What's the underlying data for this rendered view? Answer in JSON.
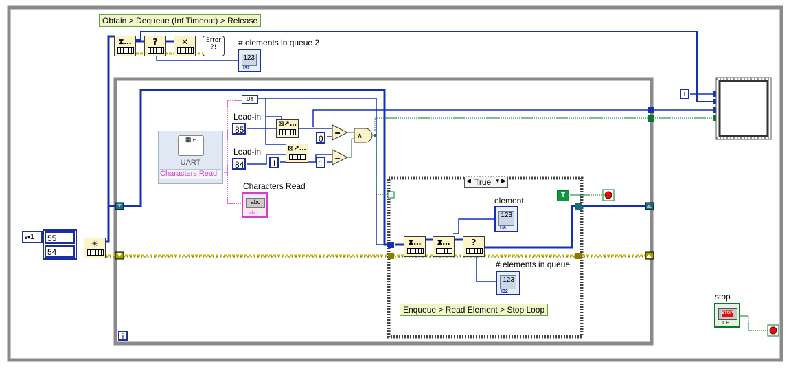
{
  "comments": {
    "top": "Obtain > Dequeue (Inf Timeout) > Release",
    "inner": "Enqueue > Read Element > Stop Loop"
  },
  "labels": {
    "elements_in_queue_2": "# elements in queue 2",
    "lead_in_1": "Lead-in",
    "lead_in_2": "Lead-in",
    "characters_read": "Characters Read",
    "element": "element",
    "elements_in_queue": "# elements in queue",
    "stop": "stop"
  },
  "constants": {
    "queue_size": "1",
    "array_v1": "55",
    "array_v2": "54",
    "lead_in_85": "85",
    "lead_in_84": "84",
    "zero": "0",
    "one_a": "1",
    "one_b": "1",
    "true_const": "T",
    "loop_iter": "i",
    "outer_iter": "i",
    "u8_tag": "U8"
  },
  "uart": {
    "title": "UART",
    "port": "Characters Read"
  },
  "case_selector": "True",
  "indicator_types": {
    "i32": "I32",
    "u8": "U8",
    "abc": "abc",
    "num_display": "123"
  },
  "colors": {
    "wire_blue": "#1530b8",
    "wire_yellow": "#c8c000",
    "wire_green": "#0a7a2a",
    "wire_pink": "#d640c8",
    "loop_gray": "#8a8a8a",
    "stop_red": "#e01010"
  },
  "icons": [
    "obtain-queue-icon",
    "dequeue-icon",
    "release-queue-icon",
    "error-handler-icon",
    "enqueue-icon",
    "preview-queue-icon",
    "queue-status-icon",
    "search-array-icon",
    "equal-icon",
    "and-icon",
    "stop-terminal-icon",
    "uart-express-vi-icon"
  ]
}
